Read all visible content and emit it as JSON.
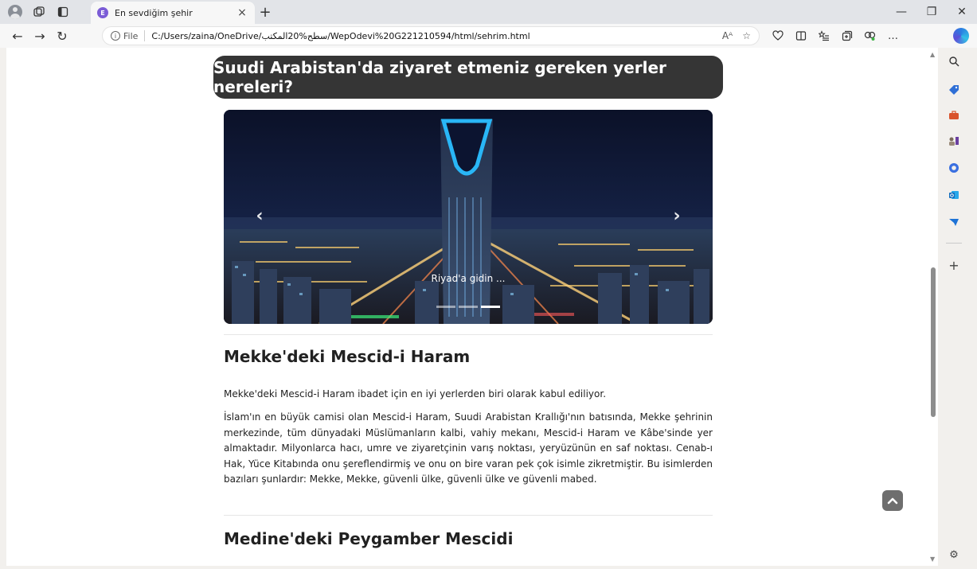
{
  "browser": {
    "tab_title": "En sevdiğim şehir",
    "tab_favicon": "E",
    "url_scheme": "File",
    "url": "C:/Users/zaina/OneDrive/سطح%20المكتب/WepOdevi%20G221210594/html/sehrim.html",
    "read_aloud_label": "Aᴬ"
  },
  "page": {
    "heading": "Suudi Arabistan'da ziyaret etmeniz gereken yerler nereleri?",
    "carousel": {
      "caption": "Riyad'a gidin ...",
      "slide_count": 3,
      "active_index": 2,
      "prev_glyph": "‹",
      "next_glyph": "›"
    },
    "sections": [
      {
        "title": "Mekke'deki Mescid-i Haram",
        "intro": "Mekke'deki Mescid-i Haram ibadet için en iyi yerlerden biri olarak kabul ediliyor.",
        "body": "İslam'ın en büyük camisi olan Mescid-i Haram, Suudi Arabistan Krallığı'nın batısında, Mekke şehrinin merkezinde, tüm dünyadaki Müslümanların kalbi, vahiy mekanı, Mescid-i Haram ve Kâbe'sinde yer almaktadır. Milyonlarca hacı, umre ve ziyaretçinin varış noktası, yeryüzünün en saf noktası. Cenab-ı Hak, Yüce Kitabında onu şereflendirmiş ve onu on bire varan pek çok isimle zikretmiştir. Bu isimlerden bazıları şunlardır: Mekke, Mekke, güvenli ülke, güvenli ülke ve güvenli mabed."
      },
      {
        "title": "Medine'deki Peygamber Mescidi"
      }
    ]
  },
  "colors": {
    "heading_bg": "#353535",
    "sky": "#0d1530",
    "tower_glow": "#29b6f6"
  },
  "icons": {
    "back": "←",
    "forward": "→",
    "reload": "↻",
    "close": "×",
    "new_tab": "+",
    "minimize": "—",
    "restore": "❐",
    "window_close": "✕",
    "favorite": "☆",
    "more": "…",
    "settings": "⚙",
    "add": "+",
    "to_top": "︿"
  }
}
